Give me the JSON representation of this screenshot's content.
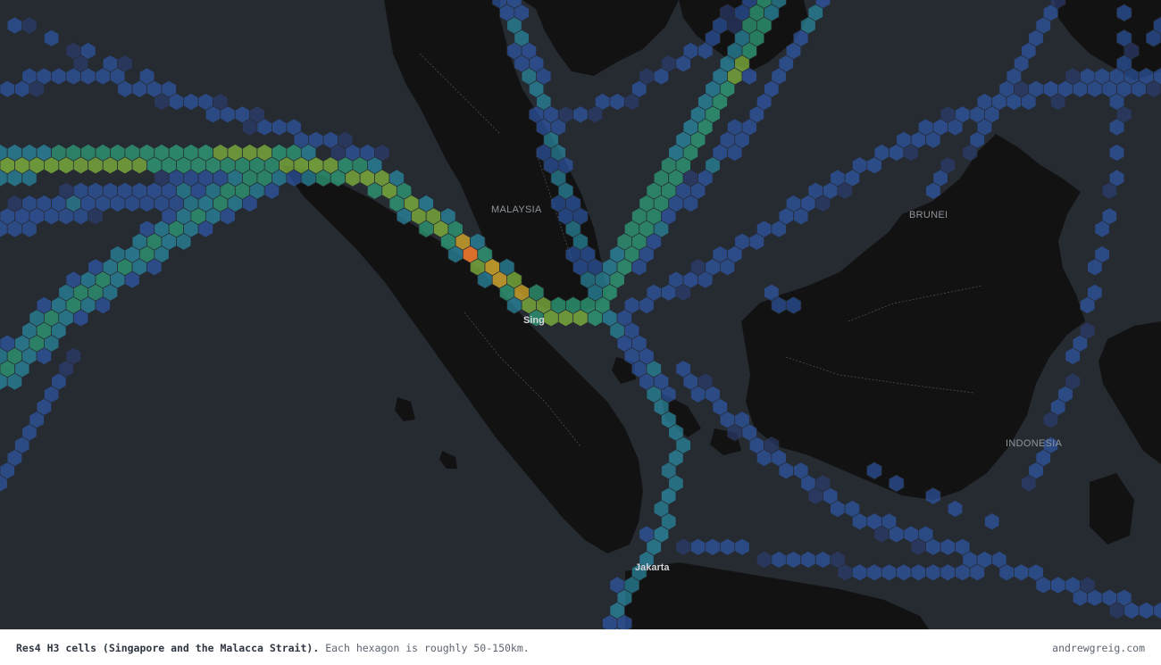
{
  "map": {
    "colors": {
      "sea": "#262b32",
      "land": "#121212",
      "border": "#4a4f56",
      "hex_ramp": [
        "#2d3f7a",
        "#2f5db5",
        "#2a8fa8",
        "#2fa07a",
        "#7daf3c",
        "#c8a02a",
        "#e9762a"
      ]
    },
    "labels": {
      "malaysia": "MALAYSIA",
      "brunei": "BRUNEI",
      "indonesia": "INDONESIA",
      "singapore": "Sing",
      "jakarta": "Jakarta"
    },
    "hex_style": "Res4 H3 hexagon density cells"
  },
  "caption": {
    "title": "Res4 H3 cells (Singapore and the Malacca Strait).",
    "description": "Each hexagon is roughly 50-150km.",
    "credit": "andrewgreig.com"
  }
}
